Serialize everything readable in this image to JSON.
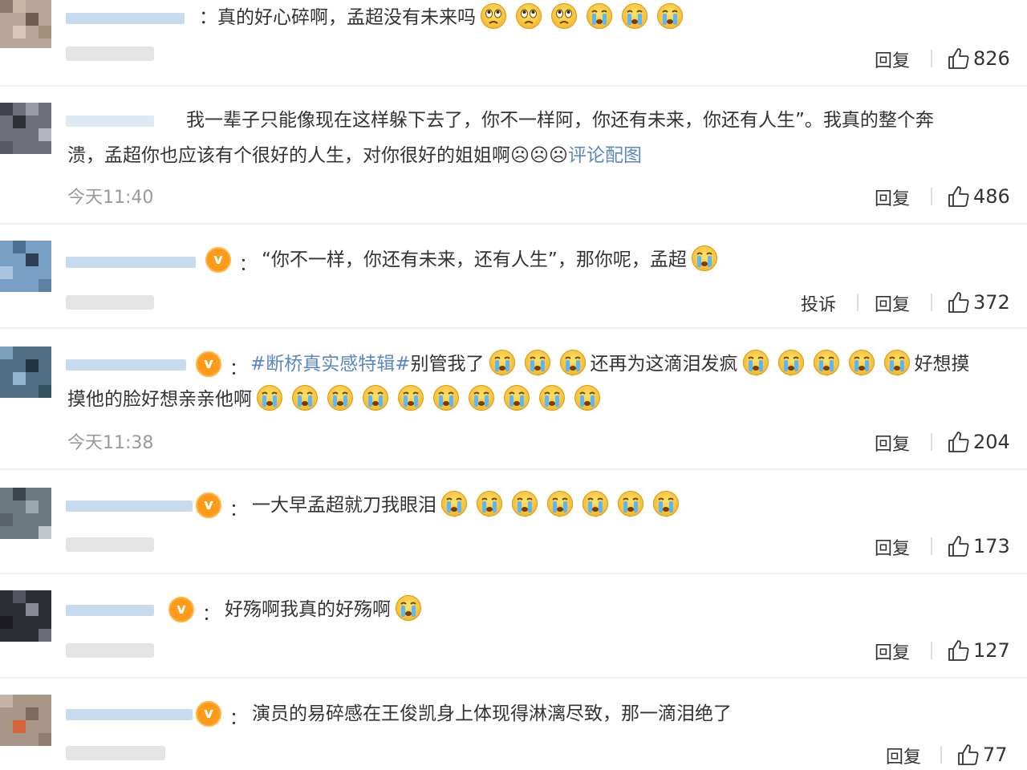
{
  "comments": [
    {
      "text_before": "：真的好心碎啊，孟超没有未来吗",
      "emojis": [
        "sad",
        "sad",
        "sad",
        "cry",
        "cry",
        "cry"
      ],
      "time": "",
      "actions": [
        "回复"
      ],
      "likes": "826"
    },
    {
      "line1": "我一辈子只能像现在这样躲下去了，你不一样阿，你还有未来，你还有人生”。我真的整个奔",
      "line2": "溃，孟超你也应该有个很好的人生，对你很好的姐姐啊☹☹☹",
      "link": "评论配图",
      "time": "今天11:40",
      "actions": [
        "回复"
      ],
      "likes": "486"
    },
    {
      "text": "“你不一样，你还有未来，还有人生”，那你呢，孟超",
      "emojis": [
        "cry"
      ],
      "actions": [
        "投诉",
        "回复"
      ],
      "likes": "372"
    },
    {
      "hashtag": "#断桥真实感特辑#",
      "seg1": "别管我了",
      "seg2": "还再为这滴泪发疯",
      "seg3": "好想摸",
      "line2": "摸他的脸好想亲亲他啊",
      "time": "今天11:38",
      "actions": [
        "回复"
      ],
      "likes": "204"
    },
    {
      "text": "一大早孟超就刀我眼泪",
      "actions": [
        "回复"
      ],
      "likes": "173"
    },
    {
      "text": "好殇啊我真的好殇啊",
      "actions": [
        "回复"
      ],
      "likes": "127"
    },
    {
      "text": "演员的易碎感在王俊凯身上体现得淋漓尽致，那一滴泪绝了",
      "actions": [
        "回复"
      ],
      "likes": "77"
    }
  ],
  "badge_letter": "v",
  "colon": "："
}
